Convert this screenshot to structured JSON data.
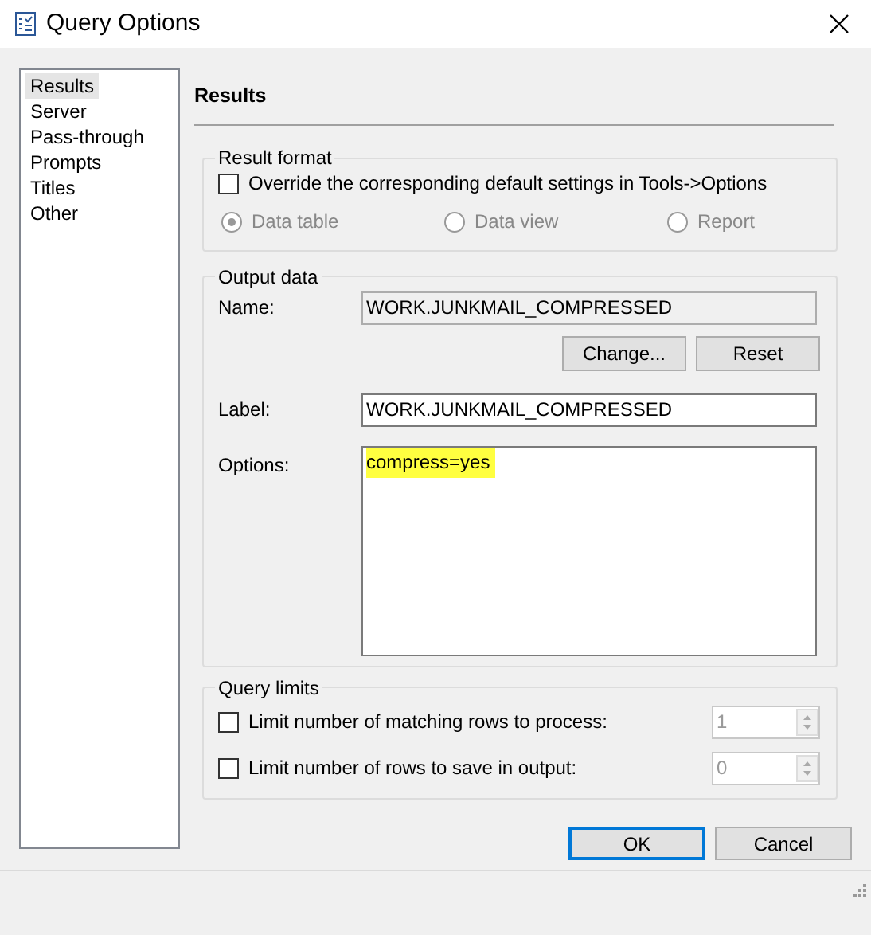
{
  "window": {
    "title": "Query Options"
  },
  "sidebar": {
    "items": [
      {
        "label": "Results",
        "selected": true
      },
      {
        "label": "Server",
        "selected": false
      },
      {
        "label": "Pass-through",
        "selected": false
      },
      {
        "label": "Prompts",
        "selected": false
      },
      {
        "label": "Titles",
        "selected": false
      },
      {
        "label": "Other",
        "selected": false
      }
    ]
  },
  "page_title": "Results",
  "result_format": {
    "legend": "Result format",
    "override": {
      "label": "Override the corresponding default settings in Tools->Options",
      "checked": false
    },
    "disabled": true,
    "views": [
      {
        "label": "Data table",
        "selected": true
      },
      {
        "label": "Data view",
        "selected": false
      },
      {
        "label": "Report",
        "selected": false
      }
    ]
  },
  "output_data": {
    "legend": "Output data",
    "name_label": "Name:",
    "name_value": "WORK.JUNKMAIL_COMPRESSED",
    "buttons": [
      "Change...",
      "Reset"
    ],
    "label_label": "Label:",
    "label_value": "WORK.JUNKMAIL_COMPRESSED",
    "options_label": "Options:",
    "options_value": "compress=yes",
    "options_highlighted": true
  },
  "query_limits": {
    "legend": "Query limits",
    "rows": [
      {
        "label": "Limit number of matching rows to process:",
        "checked": false,
        "value": "1",
        "disabled": true
      },
      {
        "label": "Limit number of rows to save in output:",
        "checked": false,
        "value": "0",
        "disabled": true
      }
    ]
  },
  "buttons": [
    {
      "label": "OK",
      "default": true
    },
    {
      "label": "Cancel",
      "default": false
    }
  ]
}
